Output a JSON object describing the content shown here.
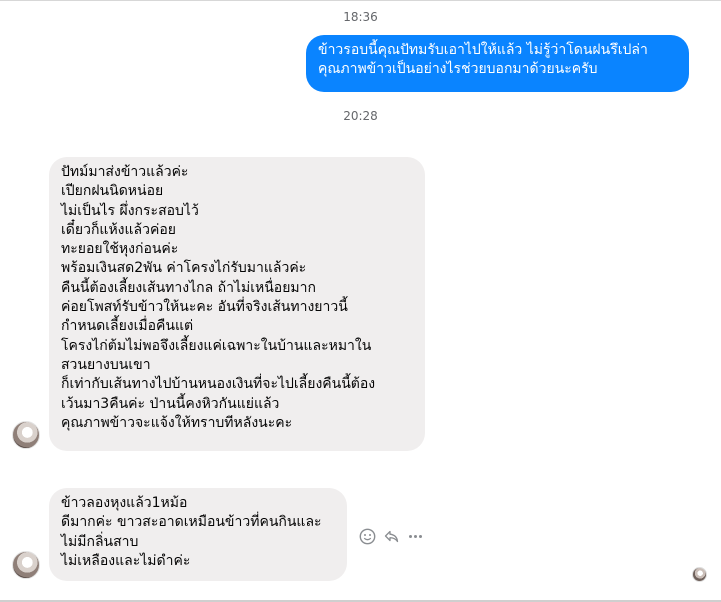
{
  "conversation": {
    "timestamps": [
      "18:36",
      "20:28"
    ],
    "messages": [
      {
        "direction": "outgoing",
        "text": "ข้าวรอบนี้คุณปัทมรับเอาไปให้แล้ว ไม่รู้ว่าโดนฝนรึเปล่า\nคุณภาพข้าวเป็นอย่างไรช่วยบอกมาด้วยนะครับ"
      },
      {
        "direction": "incoming",
        "text": "ปัทม์มาส่งข้าวแล้วค่ะ\nเปียกฝนนิดหน่อย\nไม่เป็นไร ผึ่งกระสอบไว้\nเดี๋ยวก็แห้งแล้วค่อย\nทะยอยใช้หุงก่อนค่ะ\nพร้อมเงินสด2พัน ค่าโครงไก่รับมาแล้วค่ะ\nคืนนี้ต้องเลี้ยงเส้นทางไกล ถ้าไม่เหนื่อยมาก\nค่อยโพสท์รับข้าวให้นะคะ อันที่จริงเส้นทางยาวนี้\nกำหนดเลี้ยงเมื่อคืนแต่\nโครงไก่ต้มไม่พอจึงเลี้ยงแค่เฉพาะในบ้านและหมาใน\nสวนยางบนเขา\nก็เท่ากับเส้นทางไปบ้านหนองเงินที่จะไปเลี้ยงคืนนี้ต้อง\nเว้นมา3คืนค่ะ ป่านนี้คงหิวกันแย่แล้ว\nคุณภาพข้าวจะแจ้งให้ทราบทีหลังนะคะ"
      },
      {
        "direction": "incoming",
        "text": "ข้าวลองหุงแล้ว1หม้อ\nดีมากค่ะ ขาวสะอาดเหมือนข้าวที่คนกินและ\nไม่มีกลิ่นสาบ\nไม่เหลืองและไม่ดำค่ะ"
      }
    ]
  },
  "icons": {
    "react": "smiley-icon",
    "reply": "reply-icon",
    "more": "more-icon"
  },
  "colors": {
    "outgoing_bubble": "#0a84ff",
    "incoming_bubble": "#f0eeee",
    "timestamp": "#65676b"
  }
}
